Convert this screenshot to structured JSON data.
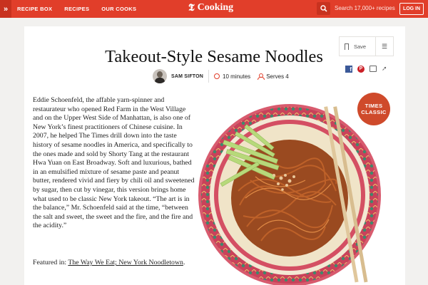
{
  "header": {
    "nav": [
      "RECIPE BOX",
      "RECIPES",
      "OUR COOKS"
    ],
    "logo": "Cooking",
    "search_placeholder": "Search 17,000+ recipes",
    "login": "LOG IN"
  },
  "recipe": {
    "title": "Takeout-Style Sesame Noodles",
    "author": "SAM SIFTON",
    "time": "10 minutes",
    "serves": "Serves 4",
    "description": "Eddie Schoenfeld, the affable yarn-spinner and restaurateur who opened Red Farm in the West Village and on the Upper West Side of Manhattan, is also one of New York’s finest practitioners of Chinese cuisine. In 2007, he helped The Times drill down into the taste history of sesame noodles in America, and specifically to the ones made and sold by Shorty Tang at the restaurant Hwa Yuan on East Broadway. Soft and luxurious, bathed in an emulsified mixture of sesame paste and peanut butter, rendered vivid and fiery by chili oil and sweetened by sugar, then cut by vinegar, this version brings home what used to be classic New York takeout. “The art is in the balance,” Mr. Schoenfeld said at the time, “between the salt and sweet, the sweet and the fire, and the fire and the acidity.”",
    "featured_prefix": "Featured in: ",
    "featured_link": "The Way We Eat; New York Noodletown",
    "featured_suffix": ".",
    "badge_line1": "TIMES",
    "badge_line2": "CLASSIC"
  },
  "actions": {
    "save": "Save"
  },
  "icons": {
    "chevron": "double-chevron-icon",
    "search": "search-icon",
    "save": "bookmark-icon",
    "menu": "menu-icon",
    "facebook": "facebook-icon",
    "pinterest": "pinterest-icon",
    "print": "print-icon",
    "share": "share-icon"
  },
  "colors": {
    "brand": "#e13e2a",
    "badge": "#cf4a2b"
  }
}
